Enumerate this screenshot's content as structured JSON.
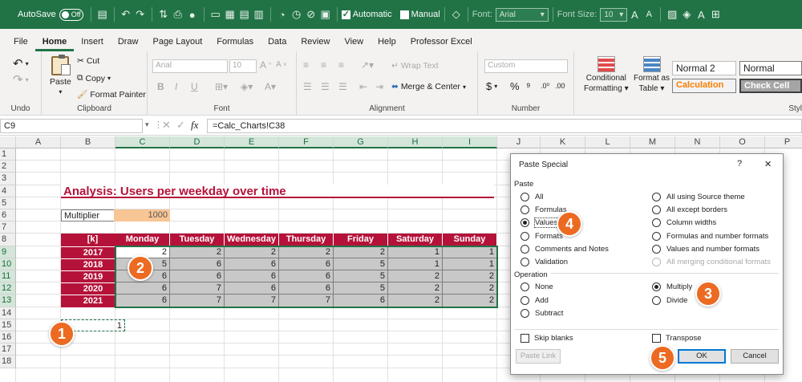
{
  "titlebar": {
    "autosave_label": "AutoSave",
    "autosave_state": "Off",
    "automatic_label": "Automatic",
    "manual_label": "Manual",
    "font_label": "Font:",
    "font_value": "Arial",
    "fontsize_label": "Font Size:",
    "fontsize_value": "10",
    "accent_color": "#217346"
  },
  "tabs": [
    "File",
    "Home",
    "Insert",
    "Draw",
    "Page Layout",
    "Formulas",
    "Data",
    "Review",
    "View",
    "Help",
    "Professor Excel"
  ],
  "ribbon": {
    "undo_group": "Undo",
    "clipboard": {
      "paste": "Paste",
      "cut": "Cut",
      "copy": "Copy",
      "format_painter": "Format Painter",
      "label": "Clipboard"
    },
    "font": {
      "name": "Arial",
      "size": "10",
      "label": "Font",
      "bold": "B",
      "italic": "I",
      "underline": "U"
    },
    "alignment": {
      "wrap": "Wrap Text",
      "merge": "Merge & Center",
      "label": "Alignment"
    },
    "number": {
      "format": "Custom",
      "currency": "$",
      "percent": "%",
      "label": "Number"
    },
    "styles": {
      "conditional": "Conditional",
      "conditional2": "Formatting",
      "format_as": "Format as",
      "table": "Table",
      "normal2": "Normal 2",
      "normal": "Normal",
      "calculation": "Calculation",
      "check_cell": "Check Cell",
      "label": "Styl"
    }
  },
  "formula_bar": {
    "name_box": "C9",
    "formula": "=Calc_Charts!C38"
  },
  "sheet": {
    "columns": [
      "A",
      "B",
      "C",
      "D",
      "E",
      "F",
      "G",
      "H",
      "I",
      "J",
      "K",
      "L",
      "M",
      "N",
      "O",
      "P"
    ],
    "rows": [
      "1",
      "2",
      "3",
      "4",
      "5",
      "6",
      "7",
      "8",
      "9",
      "10",
      "11",
      "12",
      "13",
      "14",
      "15",
      "16",
      "17",
      "18"
    ],
    "title": "Analysis: Users per weekday over time",
    "multiplier_label": "Multiplier",
    "multiplier_value": "1000",
    "table_corner": "[k]",
    "weekdays": [
      "Monday",
      "Tuesday",
      "Wednesday",
      "Thursday",
      "Friday",
      "Saturday",
      "Sunday"
    ],
    "years": [
      "2017",
      "2018",
      "2019",
      "2020",
      "2021"
    ],
    "values": [
      [
        "2",
        "2",
        "2",
        "2",
        "2",
        "1",
        "1"
      ],
      [
        "5",
        "6",
        "6",
        "6",
        "5",
        "1",
        "1"
      ],
      [
        "6",
        "6",
        "6",
        "6",
        "5",
        "2",
        "2"
      ],
      [
        "6",
        "7",
        "6",
        "6",
        "5",
        "2",
        "2"
      ],
      [
        "6",
        "7",
        "7",
        "7",
        "6",
        "2",
        "2"
      ]
    ],
    "cell_b15": "1",
    "header_color": "#b5123a"
  },
  "dialog": {
    "title": "Paste Special",
    "help": "?",
    "close": "✕",
    "paste_section": "Paste",
    "paste_left": [
      "All",
      "Formulas",
      "Values",
      "Formats",
      "Comments and Notes",
      "Validation"
    ],
    "paste_right": [
      "All using Source theme",
      "All except borders",
      "Column widths",
      "Formulas and number formats",
      "Values and number formats",
      "All merging conditional formats"
    ],
    "operation_section": "Operation",
    "operation_left": [
      "None",
      "Add",
      "Subtract"
    ],
    "operation_right": [
      "Multiply",
      "Divide"
    ],
    "skip_blanks": "Skip blanks",
    "transpose": "Transpose",
    "paste_link": "Paste Link",
    "ok": "OK",
    "cancel": "Cancel"
  },
  "badges": [
    "1",
    "2",
    "3",
    "4",
    "5"
  ],
  "badge_color": "#ec6a21"
}
